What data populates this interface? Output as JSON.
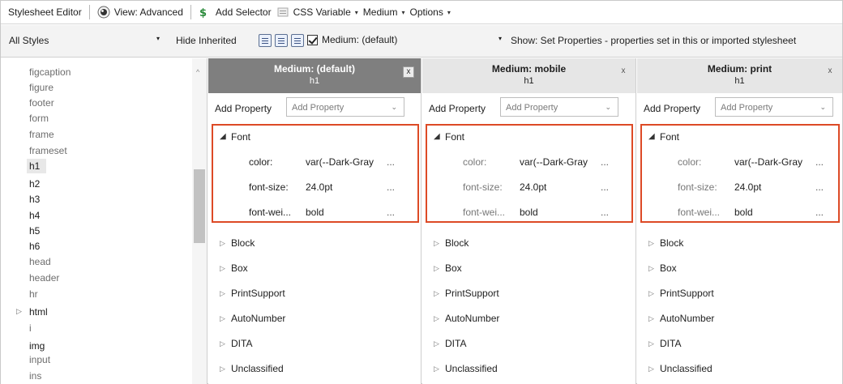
{
  "menubar": {
    "editor_label": "Stylesheet Editor",
    "view_label": "View: Advanced",
    "add_selector_label": "Add Selector",
    "css_variable_label": "CSS Variable",
    "medium_label": "Medium",
    "options_label": "Options"
  },
  "toolbar": {
    "styles_filter": "All Styles",
    "hide_inherited_label": "Hide Inherited",
    "medium_checkbox_label": "Medium: (default)",
    "show_filter": "Show: Set Properties - properties set in this or imported stylesheet"
  },
  "tree": {
    "items": [
      {
        "label": "figcaption"
      },
      {
        "label": "figure"
      },
      {
        "label": "footer"
      },
      {
        "label": "form"
      },
      {
        "label": "frame"
      },
      {
        "label": "frameset"
      },
      {
        "label": "h1"
      },
      {
        "label": "h2"
      },
      {
        "label": "h3"
      },
      {
        "label": "h4"
      },
      {
        "label": "h5"
      },
      {
        "label": "h6"
      },
      {
        "label": "head"
      },
      {
        "label": "header"
      },
      {
        "label": "hr"
      },
      {
        "label": "html"
      },
      {
        "label": "i"
      },
      {
        "label": "img"
      },
      {
        "label": "input"
      },
      {
        "label": "ins"
      }
    ]
  },
  "columns": [
    {
      "title": "Medium: (default)",
      "selector": "h1",
      "close_glyph": "x",
      "add_property_label": "Add Property",
      "add_property_placeholder": "Add Property",
      "font_group": "Font",
      "properties": [
        {
          "name": "color:",
          "value": "var(--Dark-Gray",
          "more": "..."
        },
        {
          "name": "font-size:",
          "value": "24.0pt",
          "more": "..."
        },
        {
          "name": "font-wei...",
          "value": "bold",
          "more": "..."
        }
      ],
      "groups": [
        "Block",
        "Box",
        "PrintSupport",
        "AutoNumber",
        "DITA",
        "Unclassified"
      ]
    },
    {
      "title": "Medium: mobile",
      "selector": "h1",
      "close_glyph": "x",
      "add_property_label": "Add Property",
      "add_property_placeholder": "Add Property",
      "font_group": "Font",
      "properties": [
        {
          "name": "color:",
          "value": "var(--Dark-Gray",
          "more": "..."
        },
        {
          "name": "font-size:",
          "value": "24.0pt",
          "more": "..."
        },
        {
          "name": "font-wei...",
          "value": "bold",
          "more": "..."
        }
      ],
      "groups": [
        "Block",
        "Box",
        "PrintSupport",
        "AutoNumber",
        "DITA",
        "Unclassified"
      ]
    },
    {
      "title": "Medium: print",
      "selector": "h1",
      "close_glyph": "x",
      "add_property_label": "Add Property",
      "add_property_placeholder": "Add Property",
      "font_group": "Font",
      "properties": [
        {
          "name": "color:",
          "value": "var(--Dark-Gray",
          "more": "..."
        },
        {
          "name": "font-size:",
          "value": "24.0pt",
          "more": "..."
        },
        {
          "name": "font-wei...",
          "value": "bold",
          "more": "..."
        }
      ],
      "groups": [
        "Block",
        "Box",
        "PrintSupport",
        "AutoNumber",
        "DITA",
        "Unclassified"
      ]
    }
  ],
  "colors": {
    "highlight_border": "#dd4a26",
    "active_header": "#7f7f7f",
    "inactive_header": "#e6e6e6"
  }
}
